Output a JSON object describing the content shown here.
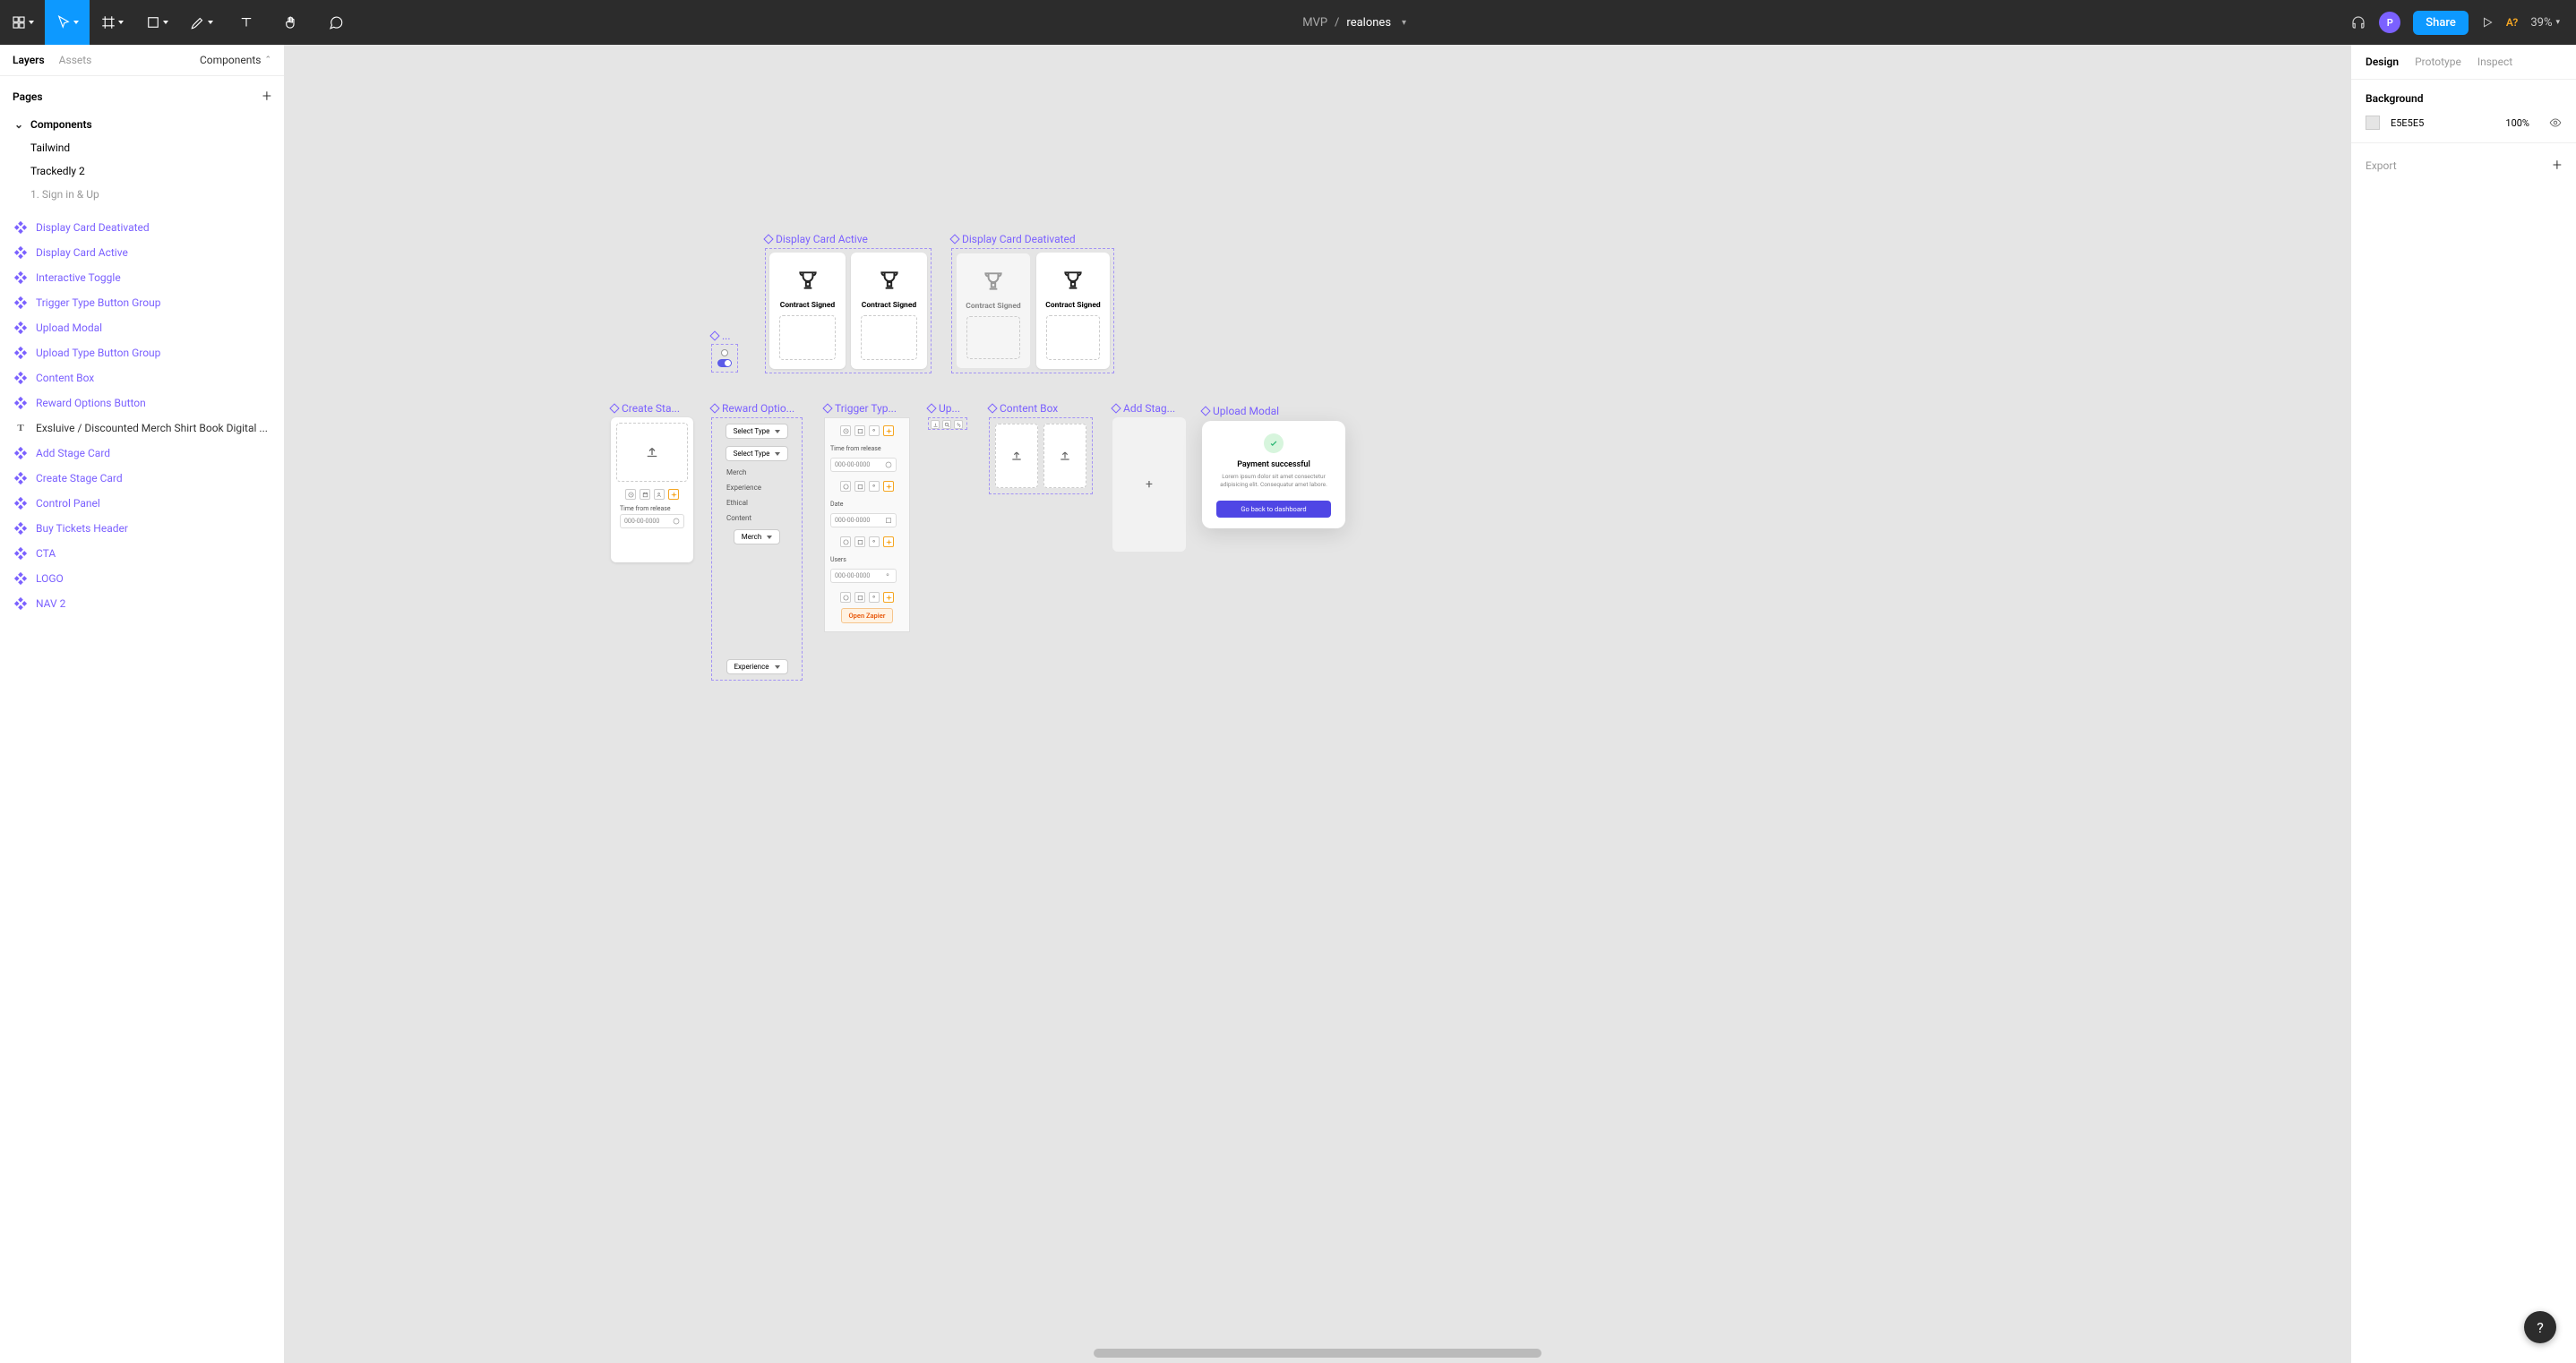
{
  "topbar": {
    "breadcrumb_project": "MVP",
    "breadcrumb_file": "realones",
    "avatar_initial": "P",
    "share_label": "Share",
    "a_badge": "A?",
    "zoom": "39%"
  },
  "left": {
    "tab_layers": "Layers",
    "tab_assets": "Assets",
    "tab_components": "Components",
    "pages_label": "Pages",
    "pages": [
      {
        "name": "Components",
        "expanded": true,
        "selected": true
      },
      {
        "name": "Tailwind"
      },
      {
        "name": "Trackedly 2"
      },
      {
        "name": "1. Sign in & Up",
        "cut": true
      }
    ],
    "layers": [
      {
        "type": "comp",
        "name": "Display Card Deativated"
      },
      {
        "type": "comp",
        "name": "Display Card Active"
      },
      {
        "type": "comp",
        "name": "Interactive Toggle"
      },
      {
        "type": "comp",
        "name": "Trigger Type Button Group"
      },
      {
        "type": "comp",
        "name": "Upload Modal"
      },
      {
        "type": "comp",
        "name": "Upload Type Button Group"
      },
      {
        "type": "comp",
        "name": "Content Box"
      },
      {
        "type": "comp",
        "name": "Reward Options Button"
      },
      {
        "type": "text",
        "name": "Exsluive / Discounted Merch Shirt Book Digital ..."
      },
      {
        "type": "comp",
        "name": "Add Stage Card"
      },
      {
        "type": "comp",
        "name": "Create Stage Card"
      },
      {
        "type": "comp",
        "name": "Control Panel"
      },
      {
        "type": "comp",
        "name": "Buy Tickets Header"
      },
      {
        "type": "comp",
        "name": "CTA"
      },
      {
        "type": "comp",
        "name": "LOGO"
      },
      {
        "type": "comp",
        "name": "NAV 2"
      }
    ]
  },
  "right": {
    "tab_design": "Design",
    "tab_prototype": "Prototype",
    "tab_inspect": "Inspect",
    "background_label": "Background",
    "bg_hex": "E5E5E5",
    "bg_opacity": "100%",
    "export_label": "Export"
  },
  "canvas": {
    "display_active_label": "Display Card Active",
    "display_deact_label": "Display Card Deativated",
    "contract_signed": "Contract Signed",
    "toggle_label": "...",
    "create_stage_label": "Create Sta...",
    "reward_label": "Reward Optio...",
    "trigger_label": "Trigger Typ...",
    "up_label": "Up...",
    "content_box_label": "Content Box",
    "add_stage_label": "Add Stag...",
    "upload_modal_label": "Upload Modal",
    "time_from_release": "Time from release",
    "date_label": "Date",
    "users_label": "Users",
    "date_placeholder": "000-00-0000",
    "select_type": "Select Type",
    "opt_merch": "Merch",
    "opt_experience": "Experience",
    "opt_ethical": "Ethical",
    "opt_content": "Content",
    "open_zapier": "Open Zapier",
    "modal_title": "Payment successful",
    "modal_sub": "Lorem ipsum dolor sit amet consectetur adipisicing elit. Consequatur amet labore.",
    "modal_btn": "Go back to dashboard",
    "plus": "+"
  }
}
